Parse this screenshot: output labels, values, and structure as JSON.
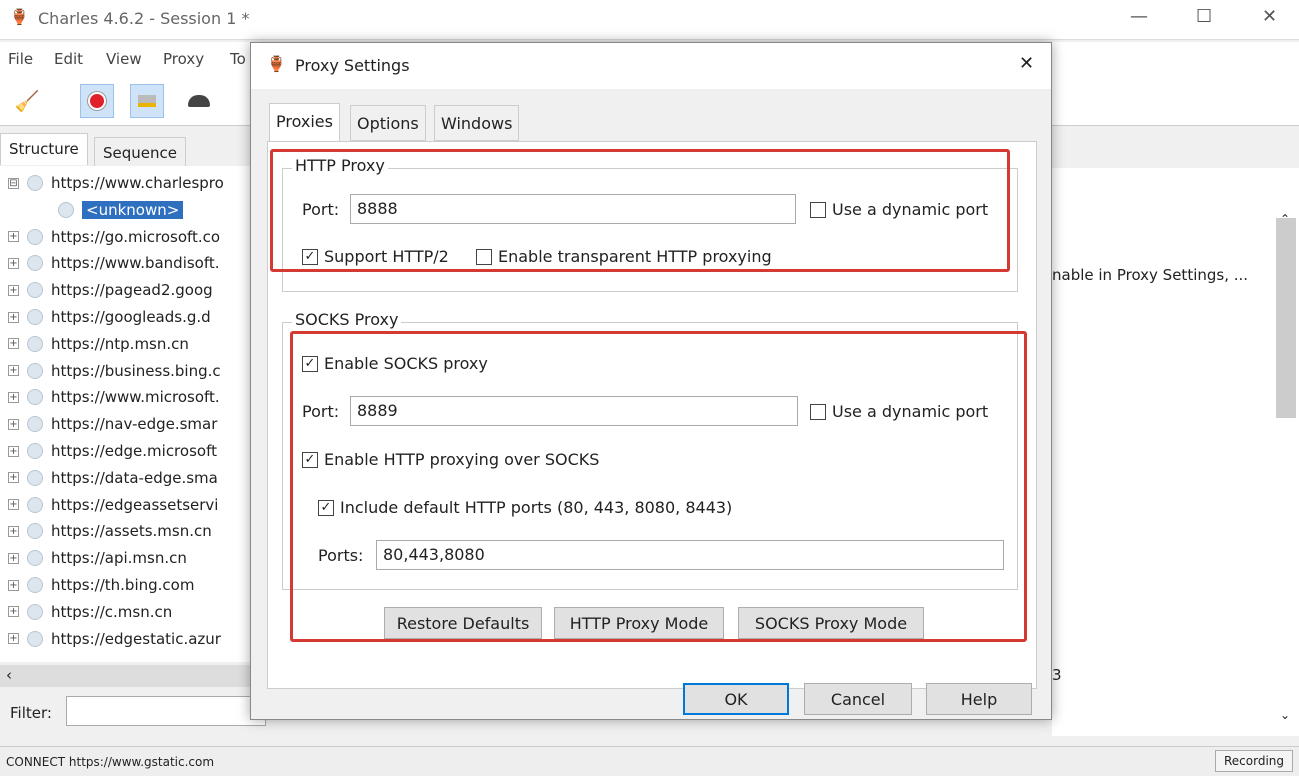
{
  "window": {
    "title": "Charles 4.6.2 - Session 1 *",
    "min": "—",
    "max": "☐",
    "close": "✕"
  },
  "menu": [
    "File",
    "Edit",
    "View",
    "Proxy",
    "To"
  ],
  "left_tabs": [
    "Structure",
    "Sequence"
  ],
  "tree": [
    {
      "label": "https://www.charlespro",
      "exp": "⊟"
    },
    {
      "label": "<unknown>",
      "child": true,
      "selected": true
    },
    {
      "label": "https://go.microsoft.co",
      "exp": "+"
    },
    {
      "label": "https://www.bandisoft.",
      "exp": "+"
    },
    {
      "label": "https://pagead2.goog",
      "exp": "+"
    },
    {
      "label": "https://googleads.g.d",
      "exp": "+"
    },
    {
      "label": "https://ntp.msn.cn",
      "exp": "+"
    },
    {
      "label": "https://business.bing.c",
      "exp": "+"
    },
    {
      "label": "https://www.microsoft.",
      "exp": "+"
    },
    {
      "label": "https://nav-edge.smar",
      "exp": "+"
    },
    {
      "label": "https://edge.microsoft",
      "exp": "+"
    },
    {
      "label": "https://data-edge.sma",
      "exp": "+"
    },
    {
      "label": "https://edgeassetservi",
      "exp": "+"
    },
    {
      "label": "https://assets.msn.cn",
      "exp": "+"
    },
    {
      "label": "https://api.msn.cn",
      "exp": "+"
    },
    {
      "label": "https://th.bing.com",
      "exp": "+"
    },
    {
      "label": "https://c.msn.cn",
      "exp": "+"
    },
    {
      "label": "https://edgestatic.azur",
      "exp": "+"
    }
  ],
  "filter_label": "Filter:",
  "status": {
    "text": "CONNECT https://www.gstatic.com",
    "recording": "Recording"
  },
  "right": {
    "text": "nable in Proxy Settings, ...",
    "partial": "3"
  },
  "dialog": {
    "title": "Proxy Settings",
    "close": "✕",
    "tabs": [
      "Proxies",
      "Options",
      "Windows"
    ],
    "http": {
      "legend": "HTTP Proxy",
      "port_label": "Port:",
      "port": "8888",
      "dynamic": "Use a dynamic port",
      "http2": "Support HTTP/2",
      "transparent": "Enable transparent HTTP proxying"
    },
    "socks": {
      "legend": "SOCKS Proxy",
      "enable": "Enable SOCKS proxy",
      "port_label": "Port:",
      "port": "8889",
      "dynamic": "Use a dynamic port",
      "over": "Enable HTTP proxying over SOCKS",
      "include": "Include default HTTP ports (80, 443, 8080, 8443)",
      "ports_label": "Ports:",
      "ports": "80,443,8080"
    },
    "buttons": {
      "restore": "Restore Defaults",
      "http_mode": "HTTP Proxy Mode",
      "socks_mode": "SOCKS Proxy Mode",
      "ok": "OK",
      "cancel": "Cancel",
      "help": "Help"
    },
    "check": "✓"
  },
  "colors": {
    "highlight": "#d43a32",
    "selection": "#2f6fc0"
  }
}
